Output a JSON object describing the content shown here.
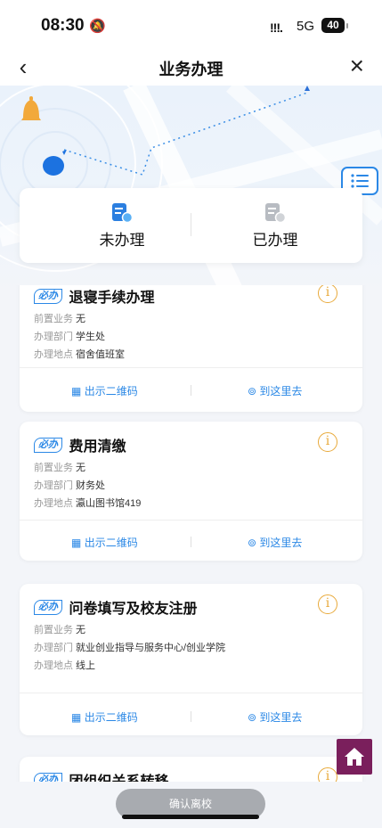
{
  "status_bar": {
    "time": "08:30",
    "mute_icon": "bell-slash-icon",
    "signal": "!!!.",
    "network": "5G",
    "battery": "40"
  },
  "nav": {
    "back_icon": "chevron-left-icon",
    "title": "业务办理",
    "close_icon": "close-icon"
  },
  "tabs": {
    "pending_label": "未办理",
    "done_label": "已办理"
  },
  "cards": [
    {
      "badge": "必办",
      "title": "退寝手续办理",
      "rows": [
        {
          "label": "前置业务",
          "value": "无"
        },
        {
          "label": "办理部门",
          "value": "学生处"
        },
        {
          "label": "办理地点",
          "value": "宿舍值班室"
        }
      ],
      "qr_label": "出示二维码",
      "go_label": "到这里去"
    },
    {
      "badge": "必办",
      "title": "费用清缴",
      "rows": [
        {
          "label": "前置业务",
          "value": "无"
        },
        {
          "label": "办理部门",
          "value": "财务处"
        },
        {
          "label": "办理地点",
          "value": "瀛山图书馆419"
        }
      ],
      "qr_label": "出示二维码",
      "go_label": "到这里去"
    },
    {
      "badge": "必办",
      "title": "问卷填写及校友注册",
      "rows": [
        {
          "label": "前置业务",
          "value": "无"
        },
        {
          "label": "办理部门",
          "value": "就业创业指导与服务中心/创业学院"
        },
        {
          "label": "办理地点",
          "value": "线上"
        }
      ],
      "qr_label": "出示二维码",
      "go_label": "到这里去"
    },
    {
      "badge": "必办",
      "title": "团组织关系转移"
    }
  ],
  "confirm_button": "确认离校",
  "colors": {
    "accent": "#2b88e6",
    "info": "#e8a93a",
    "home": "#7a1f5c",
    "button_disabled": "#a8abb0"
  }
}
